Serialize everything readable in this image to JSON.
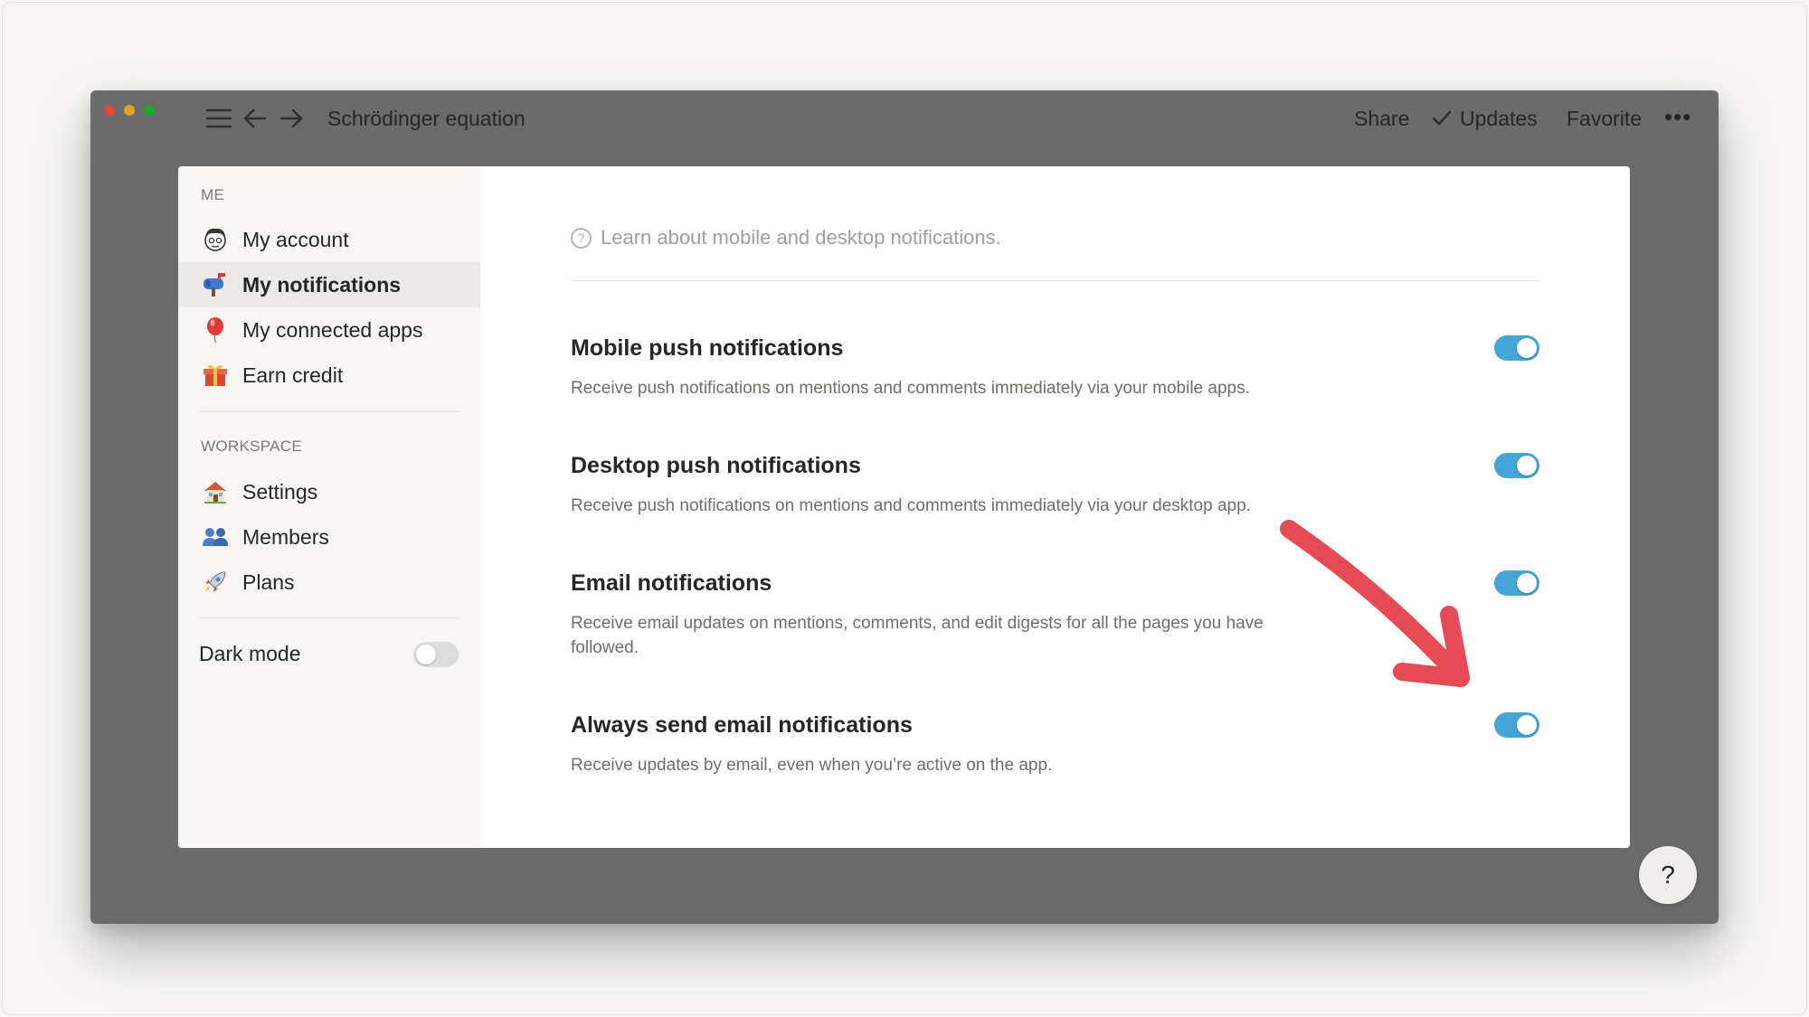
{
  "window": {
    "title": "Schrödinger equation",
    "actions": {
      "share": "Share",
      "updates": "Updates",
      "favorite": "Favorite",
      "more": "•••"
    }
  },
  "sidebar": {
    "me_label": "ME",
    "me_items": [
      {
        "label": "My account",
        "icon": "avatar-icon",
        "active": false
      },
      {
        "label": "My notifications",
        "icon": "mailbox-icon",
        "active": true
      },
      {
        "label": "My connected apps",
        "icon": "balloon-icon",
        "active": false
      },
      {
        "label": "Earn credit",
        "icon": "gift-icon",
        "active": false
      }
    ],
    "workspace_label": "WORKSPACE",
    "workspace_items": [
      {
        "label": "Settings",
        "icon": "house-icon"
      },
      {
        "label": "Members",
        "icon": "people-icon"
      },
      {
        "label": "Plans",
        "icon": "rocket-icon"
      }
    ],
    "dark_mode": {
      "label": "Dark mode",
      "enabled": false
    }
  },
  "content": {
    "learn_text": "Learn about mobile and desktop notifications.",
    "settings": [
      {
        "title": "Mobile push notifications",
        "description": "Receive push notifications on mentions and comments immediately via your mobile apps.",
        "enabled": true
      },
      {
        "title": "Desktop push notifications",
        "description": "Receive push notifications on mentions and comments immediately via your desktop app.",
        "enabled": true
      },
      {
        "title": "Email notifications",
        "description": "Receive email updates on mentions, comments, and edit digests for all the pages you have followed.",
        "enabled": true
      },
      {
        "title": "Always send email notifications",
        "description": "Receive updates by email, even when you’re active on the app.",
        "enabled": true
      }
    ]
  },
  "help_button": "?",
  "colors": {
    "toggle_on": "#46a4d6",
    "annotation_arrow": "#e54b55"
  }
}
